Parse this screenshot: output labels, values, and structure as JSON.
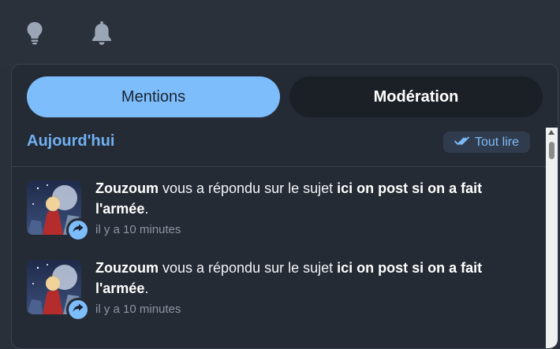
{
  "topbar": {
    "icons": [
      "lightbulb-icon",
      "bell-icon"
    ]
  },
  "tabs": [
    {
      "label": "Mentions",
      "active": true
    },
    {
      "label": "Modération",
      "active": false
    }
  ],
  "section": {
    "title": "Aujourd'hui",
    "read_all_label": "Tout lire"
  },
  "notifications": [
    {
      "user": "Zouzoum",
      "action": " vous a répondu sur le sujet ",
      "topic": "ici on post si on a fait l'armée",
      "punct": ".",
      "time": "il y a 10 minutes",
      "badge_icon": "reply-arrow-icon"
    },
    {
      "user": "Zouzoum",
      "action": " vous a répondu sur le sujet ",
      "topic": "ici on post si on a fait l'armée",
      "punct": ".",
      "time": "il y a 10 minutes",
      "badge_icon": "reply-arrow-icon"
    }
  ],
  "colors": {
    "accent": "#7dbdfc",
    "panel": "#252b34",
    "section_title": "#6fb0f2"
  }
}
